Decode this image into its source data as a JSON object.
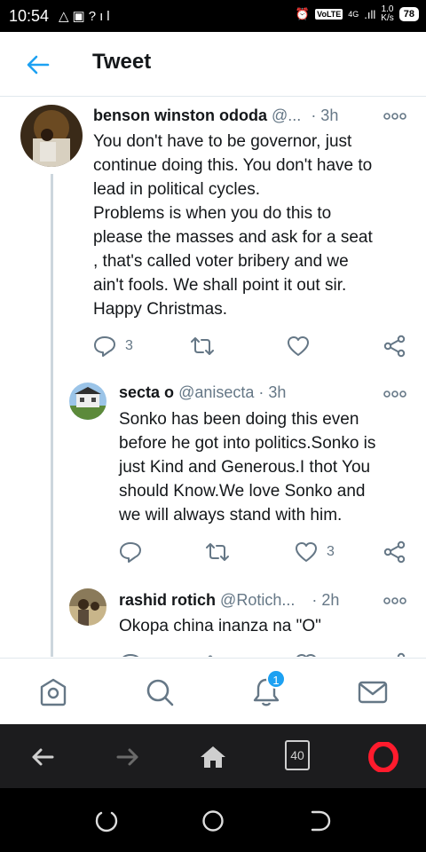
{
  "status_bar": {
    "time": "10:54",
    "network": "4G",
    "volte": "VoLTE",
    "speed_value": "1.0",
    "speed_unit": "K/s",
    "battery": "78"
  },
  "header": {
    "title": "Tweet"
  },
  "tweets": [
    {
      "name": "benson winston ododa",
      "handle": "@...",
      "time": "· 3h",
      "text_lines": [
        "You don't have to be governor, just",
        "continue doing this. You don't have to",
        "lead in political cycles.",
        "Problems is when you do this to",
        "please the masses and ask for a seat",
        ", that's called voter bribery and we",
        "ain't fools. We shall point it out sir.",
        "Happy Christmas."
      ],
      "reply_count": "3",
      "retweet_count": "",
      "like_count": ""
    },
    {
      "name": "secta o",
      "handle": "@anisecta",
      "time": "· 3h",
      "text_lines": [
        "Sonko has been doing this even",
        "before he got into politics.Sonko is",
        "just Kind and Generous.I thot You",
        "should Know.We love Sonko and",
        "we will always stand with him."
      ],
      "reply_count": "",
      "retweet_count": "",
      "like_count": "3"
    },
    {
      "name": "rashid rotich",
      "handle": "@Rotich...",
      "time": "· 2h",
      "text_lines": [
        "Okopa china inanza na \"O\""
      ]
    }
  ],
  "tabbar": {
    "notifications_badge": "1"
  },
  "browser": {
    "tab_count": "40"
  },
  "colors": {
    "accent": "#1da1f2",
    "muted": "#657786",
    "opera_red": "#ff1b2d"
  }
}
